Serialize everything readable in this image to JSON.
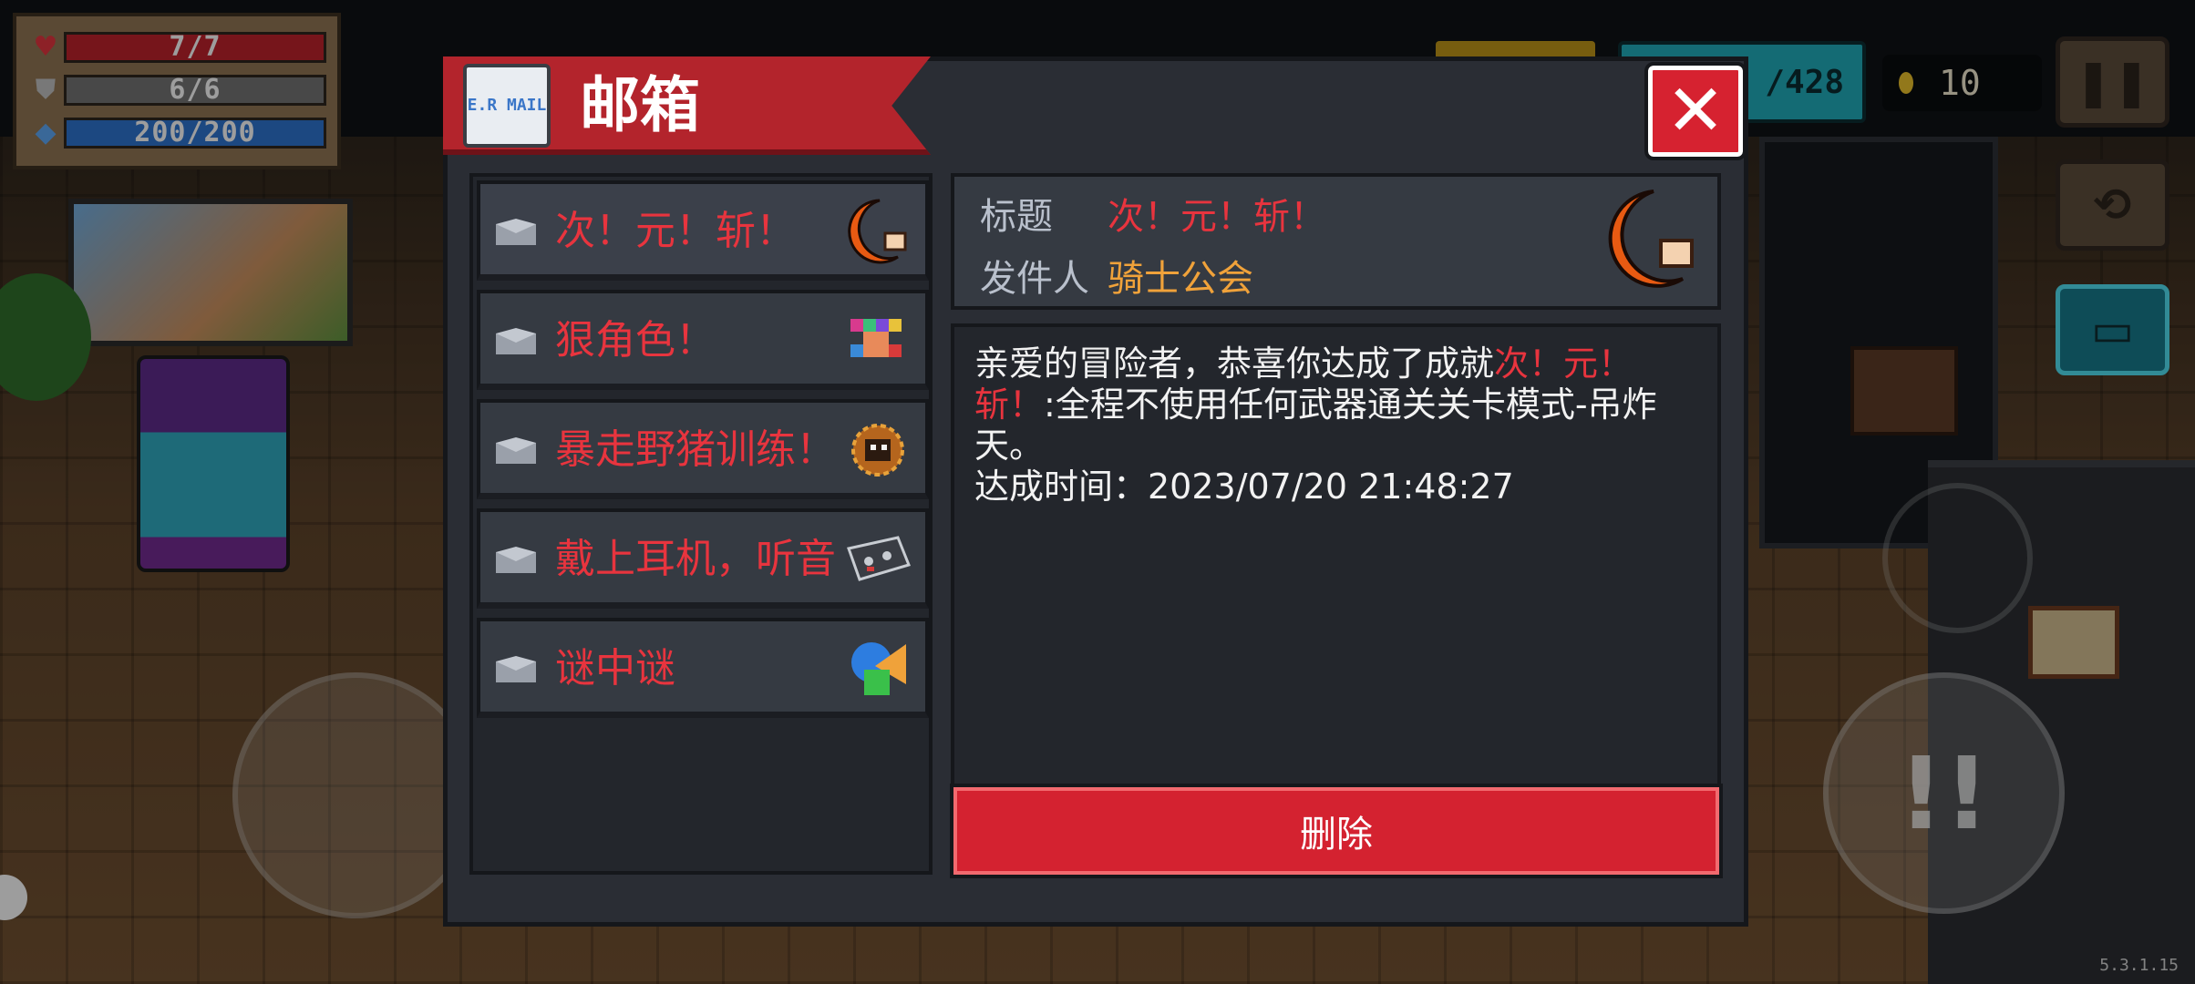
{
  "stats": {
    "hp": "7/7",
    "armor": "6/6",
    "energy": "200/200"
  },
  "hud": {
    "gems_partial": "/428",
    "coins": "10",
    "pause_icon": "pause-icon",
    "swap_icon": "swap-weapon-icon",
    "chest_icon": "chest-icon"
  },
  "dialog": {
    "title": "邮箱",
    "mail_icon_text": "E.R MAIL",
    "close_label": "✕"
  },
  "mails": [
    {
      "subject": "次！元！斩！",
      "thumb": "crescent-slash-icon",
      "selected": true
    },
    {
      "subject": "狠角色！",
      "thumb": "pixel-character-icon",
      "selected": false
    },
    {
      "subject": "暴走野猪训练！",
      "thumb": "boar-icon",
      "selected": false
    },
    {
      "subject": "戴上耳机，听音",
      "thumb": "cassette-icon",
      "selected": false
    },
    {
      "subject": "谜中谜",
      "thumb": "shapes-icon",
      "selected": false
    }
  ],
  "detail": {
    "title_label": "标题",
    "title_value": "次！元！斩！",
    "sender_label": "发件人",
    "sender_value": "骑士公会",
    "body_pre": "亲爱的冒险者，恭喜你达成了成就",
    "body_highlight": "次！元！斩！",
    "body_post": ":全程不使用任何武器通关关卡模式-吊炸天。",
    "achieved_line": "达成时间：2023/07/20 21:48:27",
    "delete_label": "删除"
  },
  "colors": {
    "accent_red": "#e8343e",
    "sender_orange": "#f0a23a",
    "panel": "#2a2d34"
  },
  "version": "5.3.1.15"
}
